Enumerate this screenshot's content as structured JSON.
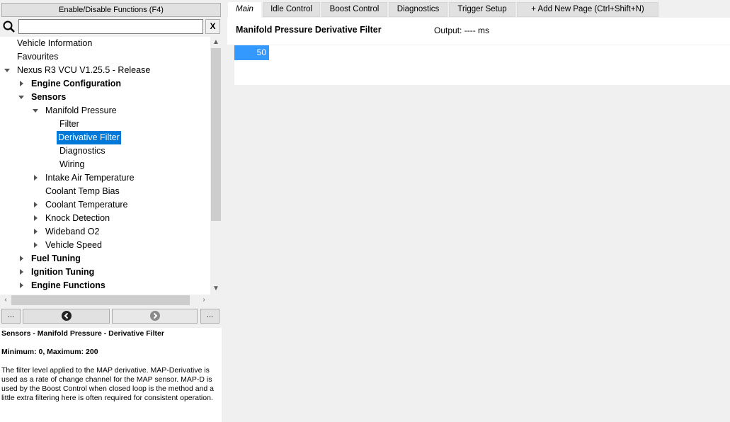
{
  "left_panel": {
    "toggle_button": "Enable/Disable Functions (F4)",
    "search_placeholder": "",
    "clear_label": "X",
    "tree": [
      {
        "label": "Vehicle Information",
        "bold": false,
        "arrow": "none",
        "selected": false
      },
      {
        "label": "Favourites",
        "bold": false,
        "arrow": "none",
        "selected": false
      },
      {
        "label": "Nexus R3 VCU V1.25.5 - Release",
        "bold": false,
        "arrow": "down",
        "selected": false
      },
      {
        "label": "Engine Configuration",
        "bold": true,
        "arrow": "right",
        "selected": false
      },
      {
        "label": "Sensors",
        "bold": true,
        "arrow": "down",
        "selected": false
      },
      {
        "label": "Manifold Pressure",
        "bold": false,
        "arrow": "down",
        "selected": false
      },
      {
        "label": "Filter",
        "bold": false,
        "arrow": "none",
        "selected": false
      },
      {
        "label": "Derivative Filter",
        "bold": false,
        "arrow": "none",
        "selected": true
      },
      {
        "label": "Diagnostics",
        "bold": false,
        "arrow": "none",
        "selected": false
      },
      {
        "label": "Wiring",
        "bold": false,
        "arrow": "none",
        "selected": false
      },
      {
        "label": "Intake Air Temperature",
        "bold": false,
        "arrow": "right",
        "selected": false
      },
      {
        "label": "Coolant Temp Bias",
        "bold": false,
        "arrow": "none",
        "selected": false
      },
      {
        "label": "Coolant Temperature",
        "bold": false,
        "arrow": "right",
        "selected": false
      },
      {
        "label": "Knock Detection",
        "bold": false,
        "arrow": "right",
        "selected": false
      },
      {
        "label": "Wideband O2",
        "bold": false,
        "arrow": "right",
        "selected": false
      },
      {
        "label": "Vehicle Speed",
        "bold": false,
        "arrow": "right",
        "selected": false
      },
      {
        "label": "Fuel Tuning",
        "bold": true,
        "arrow": "right",
        "selected": false
      },
      {
        "label": "Ignition Tuning",
        "bold": true,
        "arrow": "right",
        "selected": false
      },
      {
        "label": "Engine Functions",
        "bold": true,
        "arrow": "right",
        "selected": false
      }
    ],
    "nav": {
      "more_left": "...",
      "more_right": "..."
    },
    "description": {
      "path": "Sensors - Manifold Pressure - Derivative Filter",
      "range": "Minimum: 0, Maximum: 200",
      "body": "The filter level applied to the MAP derivative. MAP-Derivative is used as a rate of change channel for the MAP sensor. MAP-D is used by the Boost Control when closed loop is the method and a little extra filtering here is often required for consistent operation."
    }
  },
  "tabs": [
    {
      "label": "Main",
      "active": true
    },
    {
      "label": "Idle Control",
      "active": false
    },
    {
      "label": "Boost Control",
      "active": false
    },
    {
      "label": "Diagnostics",
      "active": false
    },
    {
      "label": "Trigger Setup",
      "active": false
    },
    {
      "label": "+ Add New Page (Ctrl+Shift+N)",
      "active": false
    }
  ],
  "main": {
    "title": "Manifold Pressure Derivative Filter",
    "output_label": "Output:",
    "output_value": "----",
    "output_unit": "ms",
    "value": "50"
  },
  "colors": {
    "selection": "#0078d7",
    "value_cell": "#3399ff"
  }
}
